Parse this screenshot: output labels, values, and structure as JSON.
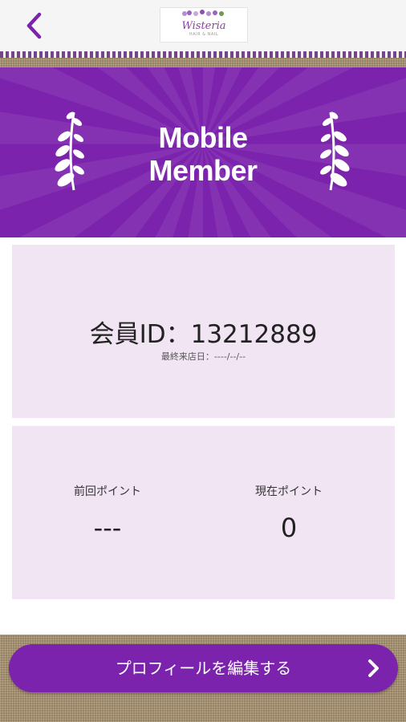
{
  "header": {
    "back_icon": "chevron-left-icon",
    "logo_text": "Wisteria",
    "logo_subtext": "HAIR & NAIL"
  },
  "banner": {
    "line1": "Mobile",
    "line2": "Member",
    "decoration_icon": "laurel-branch-icon"
  },
  "member": {
    "id_text": "会員ID：13212889",
    "last_visit_text": "最終来店日：----/--/--"
  },
  "points": {
    "previous_label": "前回ポイント",
    "previous_value": "---",
    "current_label": "現在ポイント",
    "current_value": "0"
  },
  "actions": {
    "edit_profile_label": "プロフィールを編集する",
    "edit_profile_icon": "chevron-right-icon"
  },
  "colors": {
    "accent": "#7b23ac",
    "card_bg": "#f1e5f4"
  }
}
